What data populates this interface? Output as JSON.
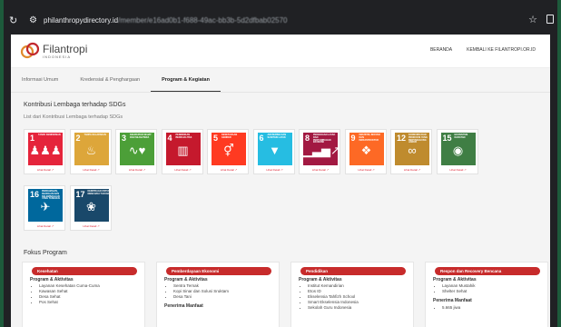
{
  "browser": {
    "url_host": "philanthropydirectory.id",
    "url_path": "/member/e16ad0b1-f688-49ac-bb3b-5d2dfbab02570"
  },
  "header": {
    "logo_name": "Filantropi",
    "logo_sub": "INDONESIA",
    "nav": [
      "BERANDA",
      "KEMBALI KE FILANTROPI.OR.ID"
    ]
  },
  "tabs": [
    {
      "label": "Informasi Umum",
      "active": false
    },
    {
      "label": "Kredensial & Penghargaan",
      "active": false
    },
    {
      "label": "Program & Kegiatan",
      "active": true
    }
  ],
  "sdg_section": {
    "title": "Kontribusi Lembaga terhadap SDGs",
    "subtitle": "List dari Kontribusi Lembaga terhadap SDGs",
    "link_label": "Lihat Detail ↗",
    "goals": [
      {
        "num": "1",
        "label": "TANPA KEMISKINAN",
        "color": "#e5243b",
        "glyph": "♟♟♟"
      },
      {
        "num": "2",
        "label": "TANPA KELAPARAN",
        "color": "#dda63a",
        "glyph": "♨"
      },
      {
        "num": "3",
        "label": "KEHIDUPAN SEHAT DAN SEJAHTERA",
        "color": "#4c9f38",
        "glyph": "∿♥"
      },
      {
        "num": "4",
        "label": "PENDIDIKAN BERKUALITAS",
        "color": "#c5192d",
        "glyph": "▥"
      },
      {
        "num": "5",
        "label": "KESETARAAN GENDER",
        "color": "#ff3a21",
        "glyph": "⚥"
      },
      {
        "num": "6",
        "label": "AIR BERSIH DAN SANITASI LAYAK",
        "color": "#26bde2",
        "glyph": "▼"
      },
      {
        "num": "8",
        "label": "PEKERJAAN LAYAK DAN PERTUMBUHAN EKONOMI",
        "color": "#a21942",
        "glyph": "▁▃▅↗"
      },
      {
        "num": "9",
        "label": "INDUSTRI, INOVASI DAN INFRASTRUKTUR",
        "color": "#fd6925",
        "glyph": "❖"
      },
      {
        "num": "12",
        "label": "KONSUMSI DAN PRODUKSI YANG BERTANGGUNG JAWAB",
        "color": "#bf8b2e",
        "glyph": "∞"
      },
      {
        "num": "15",
        "label": "EKOSISTEM DARATAN",
        "color": "#3f7e44",
        "glyph": "◉"
      },
      {
        "num": "16",
        "label": "PERDAMAIAN, KEADILAN DAN KELEMBAGAAN YANG TANGGUH",
        "color": "#00689d",
        "glyph": "✈"
      },
      {
        "num": "17",
        "label": "KEMITRAAN UNTUK MENCAPAI TUJUAN",
        "color": "#19486a",
        "glyph": "❀"
      }
    ]
  },
  "focus": {
    "title": "Fokus Program",
    "cards": [
      {
        "tag": "Kesehatan",
        "sub": "Program & Aktivitas",
        "items": [
          "Layanan Kesehatan Cuma-Cuma",
          "Kawasan Sehat",
          "Desa Sehat",
          "Pos Sehat"
        ],
        "sub2": ""
      },
      {
        "tag": "Pemberdayaan Ekonomi",
        "sub": "Program & Aktivitas",
        "items": [
          "Sentra Ternak",
          "Kopi Sinar dan Solusi Sruktam",
          "Desa Tani"
        ],
        "sub2": "Penerima Manfaat"
      },
      {
        "tag": "Pendidikan",
        "sub": "Program & Aktivitas",
        "items": [
          "Institut Kemandirian",
          "Etos ID",
          "Ekselensia Tahfizh School",
          "Smart Ekselensia Indonesia",
          "Sekolah Guru Indonesia"
        ],
        "sub2": ""
      },
      {
        "tag": "Respon dan Recovery Bencana",
        "sub": "Program & Aktivitas",
        "items": [
          "Layanan Mustahik",
          "Shelter Sehat"
        ],
        "sub2": "Penerima Manfaat",
        "items2": [
          "5.665 jiwa"
        ]
      }
    ]
  }
}
